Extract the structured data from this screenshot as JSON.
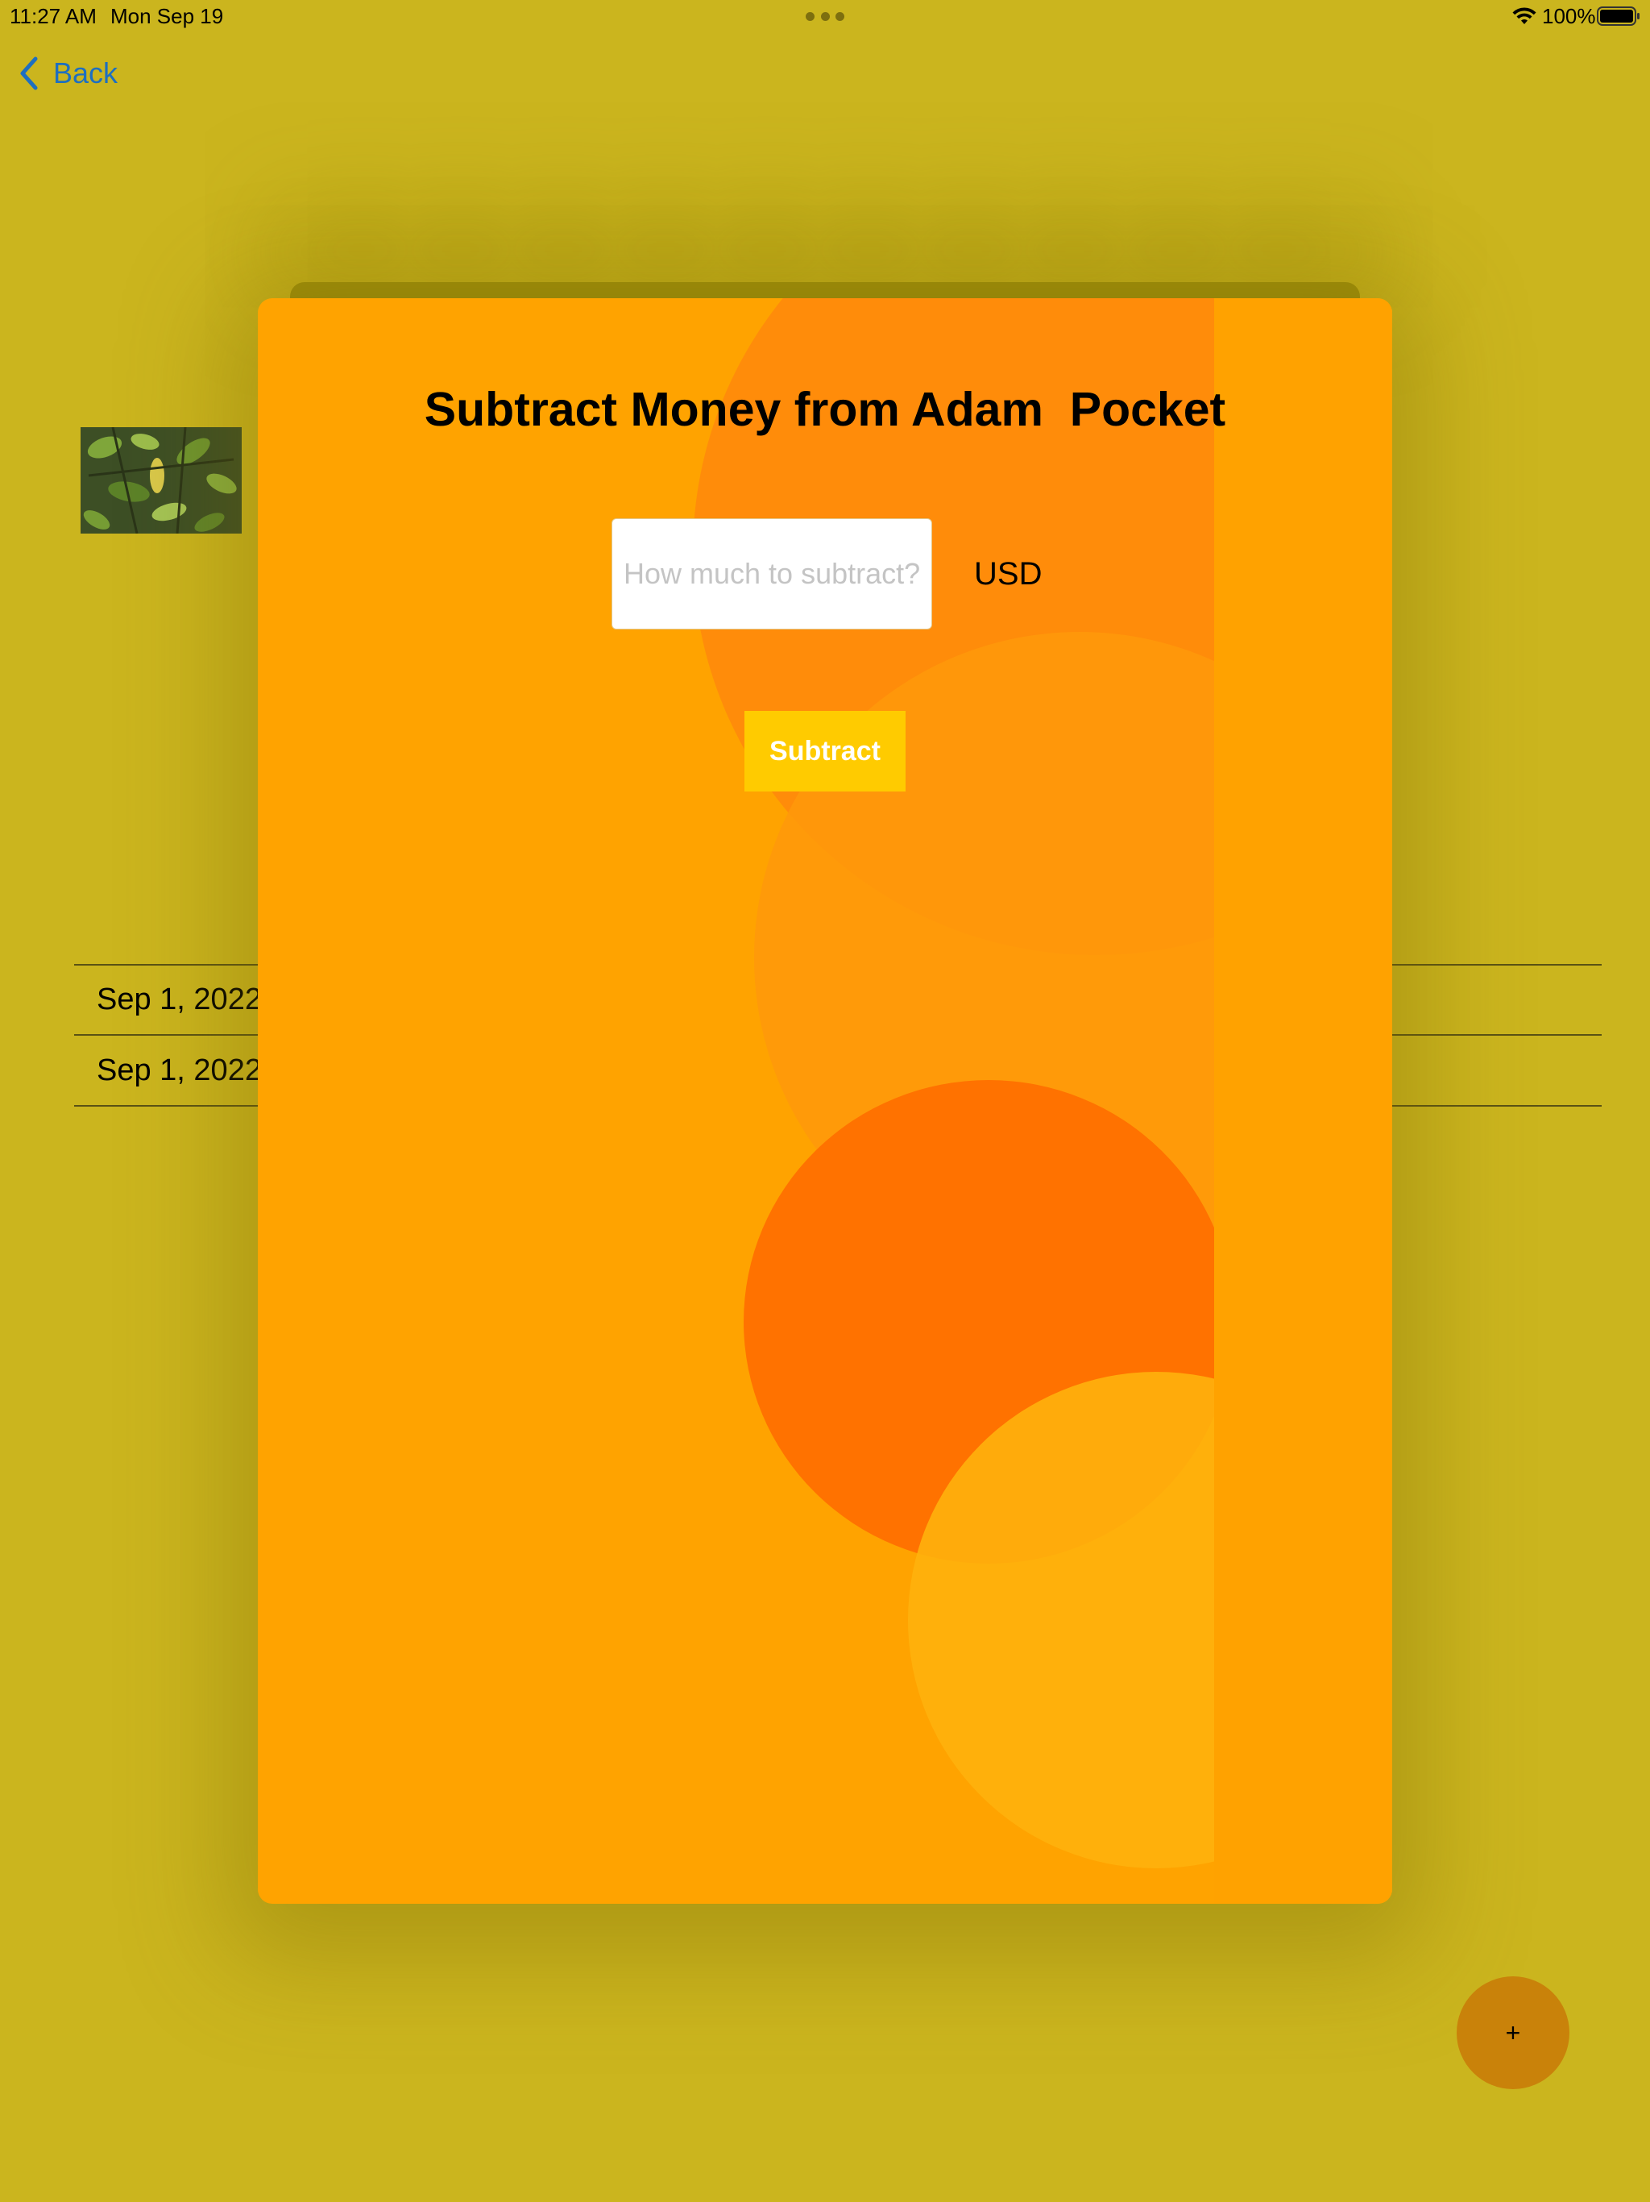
{
  "status_bar": {
    "time": "11:27 AM",
    "date": "Mon Sep 19",
    "battery_percent": "100%",
    "icons": [
      "wifi-icon",
      "battery-icon"
    ]
  },
  "nav": {
    "back_label": "Back"
  },
  "background_list": {
    "rows": [
      {
        "date": "Sep 1, 2022"
      },
      {
        "date": "Sep 1, 2022"
      }
    ]
  },
  "modal": {
    "title": "Subtract Money from Adam  Pocket",
    "amount_input": {
      "value": "",
      "placeholder": "How much to subtract?"
    },
    "currency": "USD",
    "submit_label": "Subtract"
  },
  "fab": {
    "label": "+"
  },
  "colors": {
    "backdrop": "#CBB51E",
    "modal_background": "#FFA300",
    "submit_button": "#FFCB00",
    "back_link": "#1E6FC0",
    "fab": "#C9820A"
  }
}
